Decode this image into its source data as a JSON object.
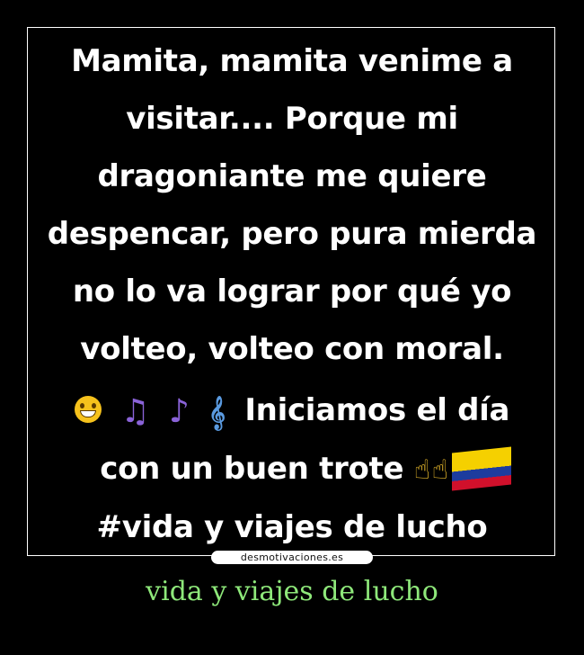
{
  "poster": {
    "lines": [
      "Mamita, mamita venime a",
      "visitar.... Porque mi",
      "dragoniante me quiere",
      "despencar, pero pura mierda",
      "no lo va lograr por qué yo",
      "volteo, volteo con moral.",
      "Iniciamos el día",
      "con un buen trote",
      "#vida y viajes de lucho"
    ],
    "icons": {
      "grin": "grinning-face-icon",
      "notes": "musical-notes-icon",
      "note": "musical-note-icon",
      "score": "musical-score-icon",
      "finger": "pointing-up-icon",
      "flag": "colombia-flag-icon"
    },
    "colors": {
      "background": "#000000",
      "text": "#ffffff",
      "caption": "#8ee87a"
    }
  },
  "watermark": "desmotivaciones.es",
  "caption": "vida y viajes de lucho"
}
